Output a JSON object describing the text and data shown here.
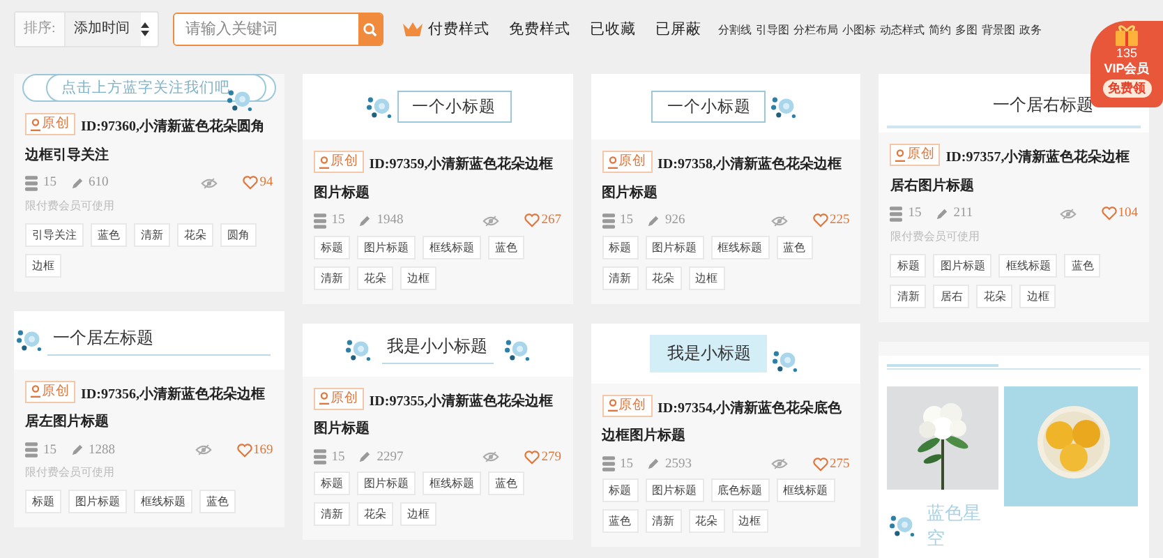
{
  "toolbar": {
    "sort_label": "排序:",
    "sort_value": "添加时间",
    "search": {
      "placeholder": "请输入关键词"
    },
    "filters": [
      {
        "label": "付费样式",
        "kind": "crown"
      },
      {
        "label": "免费样式",
        "kind": "plain"
      },
      {
        "label": "已收藏",
        "kind": "plain"
      },
      {
        "label": "已屏蔽",
        "kind": "plain"
      }
    ],
    "categories": [
      "分割线",
      "引导图",
      "分栏布局",
      "小图标",
      "动态样式",
      "简约",
      "多图",
      "背景图",
      "政务"
    ]
  },
  "vip_badge": {
    "count": "135",
    "label": "VIP会员",
    "action": "免费领"
  },
  "columns": [
    {
      "cards": [
        {
          "preview": {
            "kind": "pill",
            "text": "点击上方蓝字关注我们吧"
          },
          "badge": "原创",
          "title": "ID:97360,小清新蓝色花朵圆角边框引导关注",
          "layers": "15",
          "uses": "610",
          "likes": "94",
          "note": "限付费会员可使用",
          "tags": [
            "引导关注",
            "蓝色",
            "清新",
            "花朵",
            "圆角",
            "边框"
          ]
        },
        {
          "preview": {
            "kind": "left-underline",
            "text": "一个居左标题"
          },
          "badge": "原创",
          "title": "ID:97356,小清新蓝色花朵边框居左图片标题",
          "layers": "15",
          "uses": "1288",
          "likes": "169",
          "note": "限付费会员可使用",
          "tags": [
            "标题",
            "图片标题",
            "框线标题",
            "蓝色"
          ]
        }
      ]
    },
    {
      "cards": [
        {
          "preview": {
            "kind": "box-flower-left",
            "text": "一个小标题"
          },
          "badge": "原创",
          "title": "ID:97359,小清新蓝色花朵边框图片标题",
          "layers": "15",
          "uses": "1948",
          "likes": "267",
          "tags": [
            "标题",
            "图片标题",
            "框线标题",
            "蓝色",
            "清新",
            "花朵",
            "边框"
          ]
        },
        {
          "preview": {
            "kind": "flowers-both",
            "text": "我是小小标题"
          },
          "badge": "原创",
          "title": "ID:97355,小清新蓝色花朵边框图片标题",
          "layers": "15",
          "uses": "2297",
          "likes": "279",
          "tags": [
            "标题",
            "图片标题",
            "框线标题",
            "蓝色",
            "清新",
            "花朵",
            "边框"
          ]
        }
      ]
    },
    {
      "cards": [
        {
          "preview": {
            "kind": "box-flower-right",
            "text": "一个小标题"
          },
          "badge": "原创",
          "title": "ID:97358,小清新蓝色花朵边框图片标题",
          "layers": "15",
          "uses": "926",
          "likes": "225",
          "tags": [
            "标题",
            "图片标题",
            "框线标题",
            "蓝色",
            "清新",
            "花朵",
            "边框"
          ]
        },
        {
          "preview": {
            "kind": "filled",
            "text": "我是小标题"
          },
          "badge": "原创",
          "title": "ID:97354,小清新蓝色花朵底色边框图片标题",
          "layers": "15",
          "uses": "2593",
          "likes": "275",
          "tags": [
            "标题",
            "图片标题",
            "底色标题",
            "框线标题",
            "蓝色",
            "清新",
            "花朵",
            "边框"
          ]
        }
      ]
    },
    {
      "cards": [
        {
          "preview": {
            "kind": "right-underline",
            "text": "一个居右标题"
          },
          "badge": "原创",
          "title": "ID:97357,小清新蓝色花朵边框居右图片标题",
          "layers": "15",
          "uses": "211",
          "likes": "104",
          "note": "限付费会员可使用",
          "tags": [
            "标题",
            "图片标题",
            "框线标题",
            "蓝色",
            "清新",
            "居右",
            "花朵",
            "边框"
          ]
        },
        {
          "preview": {
            "kind": "photos",
            "text": "蓝色星空"
          }
        }
      ]
    }
  ]
}
